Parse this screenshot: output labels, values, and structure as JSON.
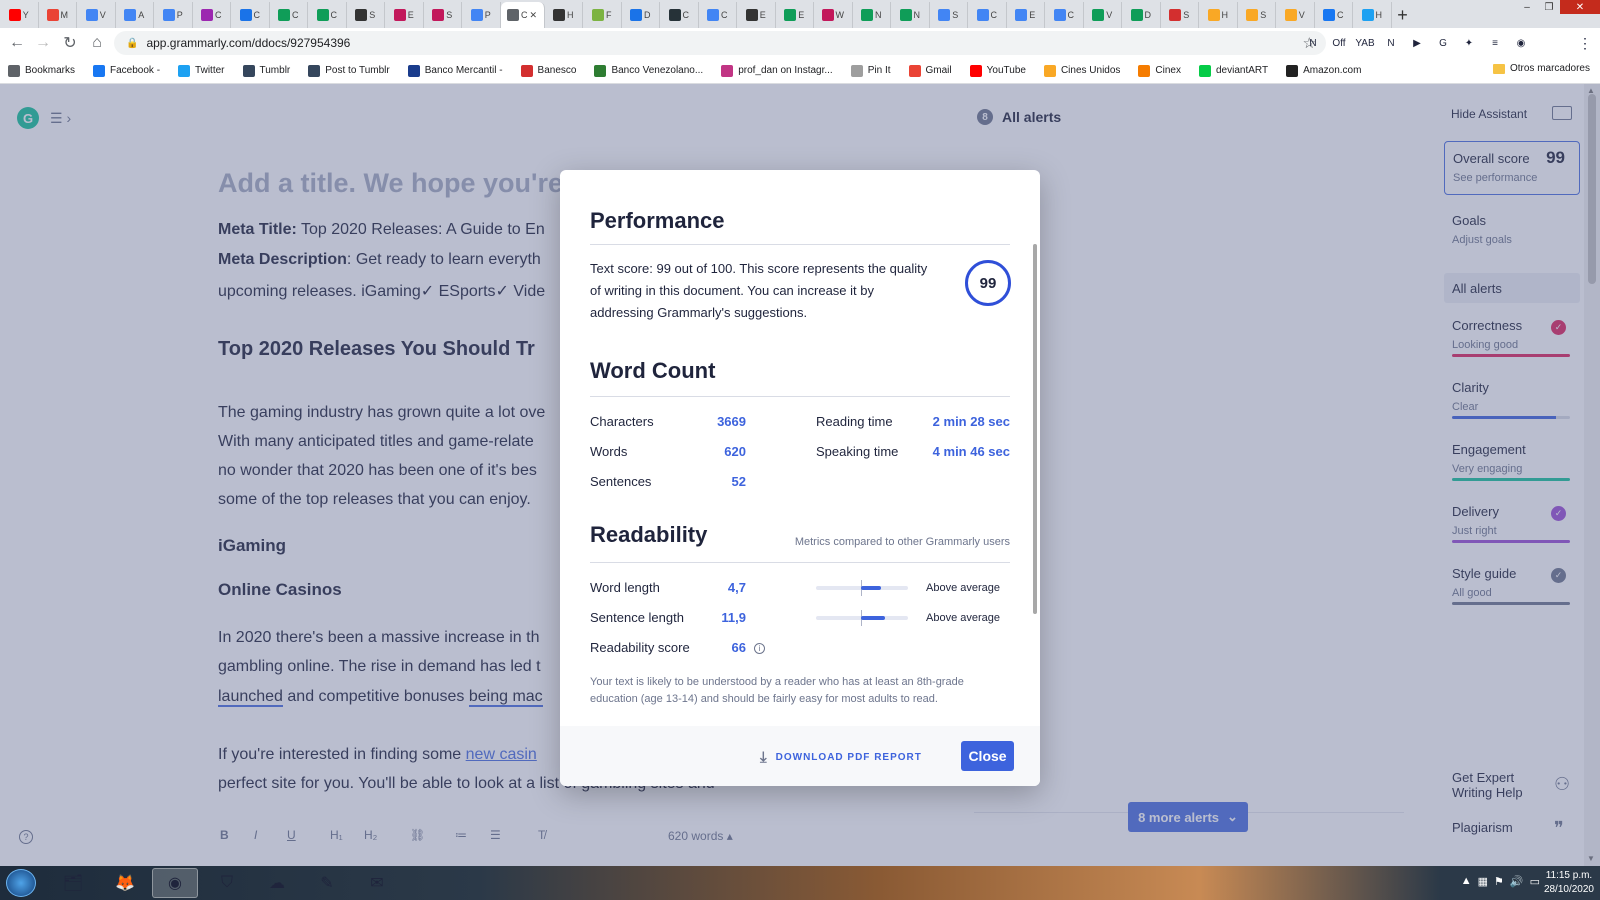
{
  "browser": {
    "url": "app.grammarly.com/ddocs/927954396",
    "tabs": [
      {
        "label": "Y",
        "color": "#ff0000"
      },
      {
        "label": "M",
        "color": "#ea4335"
      },
      {
        "label": "V",
        "color": "#4285f4"
      },
      {
        "label": "A",
        "color": "#4285f4"
      },
      {
        "label": "P",
        "color": "#4285f4"
      },
      {
        "label": "C",
        "color": "#9c27b0"
      },
      {
        "label": "C",
        "color": "#1a73e8"
      },
      {
        "label": "C",
        "color": "#0f9d58"
      },
      {
        "label": "C",
        "color": "#0f9d58"
      },
      {
        "label": "S",
        "color": "#333333"
      },
      {
        "label": "E",
        "color": "#c2185b"
      },
      {
        "label": "S",
        "color": "#c2185b"
      },
      {
        "label": "P",
        "color": "#4285f4"
      },
      {
        "label": "C",
        "color": "#5f6368"
      },
      {
        "label": "H",
        "color": "#333333"
      },
      {
        "label": "F",
        "color": "#7cb342"
      },
      {
        "label": "D",
        "color": "#1a73e8"
      },
      {
        "label": "C",
        "color": "#263238"
      },
      {
        "label": "C",
        "color": "#4285f4"
      },
      {
        "label": "E",
        "color": "#333333"
      },
      {
        "label": "E",
        "color": "#0f9d58"
      },
      {
        "label": "W",
        "color": "#c2185b"
      },
      {
        "label": "N",
        "color": "#0f9d58"
      },
      {
        "label": "N",
        "color": "#0f9d58"
      },
      {
        "label": "S",
        "color": "#4285f4"
      },
      {
        "label": "C",
        "color": "#4285f4"
      },
      {
        "label": "E",
        "color": "#4285f4"
      },
      {
        "label": "C",
        "color": "#4285f4"
      },
      {
        "label": "V",
        "color": "#0f9d58"
      },
      {
        "label": "D",
        "color": "#0f9d58"
      },
      {
        "label": "S",
        "color": "#d32f2f"
      },
      {
        "label": "H",
        "color": "#f9a825"
      },
      {
        "label": "S",
        "color": "#f9a825"
      },
      {
        "label": "V",
        "color": "#f9a825"
      },
      {
        "label": "C",
        "color": "#1877f2"
      },
      {
        "label": "H",
        "color": "#1da1f2"
      }
    ],
    "active_tab_label": "C",
    "bookmarks": [
      {
        "label": "Bookmarks",
        "color": "#5f6368"
      },
      {
        "label": "Facebook -",
        "color": "#1877f2"
      },
      {
        "label": "Twitter",
        "color": "#1da1f2"
      },
      {
        "label": "Tumblr",
        "color": "#35465c"
      },
      {
        "label": "Post to Tumblr",
        "color": "#35465c"
      },
      {
        "label": "Banco Mercantil -",
        "color": "#1a3c8c"
      },
      {
        "label": "Banesco",
        "color": "#d32f2f"
      },
      {
        "label": "Banco Venezolano...",
        "color": "#2e7d32"
      },
      {
        "label": "prof_dan on Instagr...",
        "color": "#c13584"
      },
      {
        "label": "Pin It",
        "color": "#9e9e9e"
      },
      {
        "label": "Gmail",
        "color": "#ea4335"
      },
      {
        "label": "YouTube",
        "color": "#ff0000"
      },
      {
        "label": "Cines Unidos",
        "color": "#f9a825"
      },
      {
        "label": "Cinex",
        "color": "#f57c00"
      },
      {
        "label": "deviantART",
        "color": "#05cc47"
      },
      {
        "label": "Amazon.com",
        "color": "#222222"
      }
    ],
    "other_bookmarks": "Otros marcadores",
    "extensions": [
      "N",
      "Off",
      "YAB",
      "N",
      "▶",
      "G",
      "✦",
      "≡",
      "◉"
    ]
  },
  "editor": {
    "top_alerts_count": "8",
    "top_alerts_label": "All alerts",
    "title_placeholder": "Add a title. We hope you're",
    "meta_title_label": "Meta Title:",
    "meta_title_text": " Top 2020 Releases: A Guide to En",
    "meta_desc_label": "Meta Description",
    "meta_desc_text": ": Get ready to learn everyth",
    "meta_desc_line2": "upcoming releases. iGaming✓ ESports✓ Vide",
    "heading1": "Top 2020 Releases You Should Tr",
    "para1": [
      "The gaming industry has grown quite a lot ove",
      "With many anticipated titles and game-relate",
      "no wonder that 2020 has been one of it's bes",
      "some of the top releases that you can enjoy."
    ],
    "heading_igaming": "iGaming",
    "heading_casinos": "Online Casinos",
    "para2_line1": "In 2020 there's been a massive increase in th",
    "para2_line2": "gambling online. The rise in demand has led t",
    "para2_line3a": "launched",
    "para2_line3b": " and competitive bonuses ",
    "para2_line3c": "being mac",
    "para3_line1a": "If you're interested in finding some ",
    "para3_line1b": "new casin",
    "para3_line2": "perfect site for you. You'll be able to look at a list of gambling sites and",
    "word_count": "620 words ▴",
    "more_alerts": "8 more alerts"
  },
  "sidebar": {
    "hide_assistant": "Hide Assistant",
    "overall_score_label": "Overall score",
    "overall_score": "99",
    "see_performance": "See performance",
    "goals": "Goals",
    "adjust_goals": "Adjust goals",
    "all_alerts": "All alerts",
    "categories": [
      {
        "name": "Correctness",
        "status": "Looking good",
        "color": "#e0245e",
        "check": true
      },
      {
        "name": "Clarity",
        "status": "Clear",
        "color": "#3d63dd",
        "check": false
      },
      {
        "name": "Engagement",
        "status": "Very engaging",
        "color": "#15c39a",
        "check": false
      },
      {
        "name": "Delivery",
        "status": "Just right",
        "color": "#9c4fd6",
        "check": true
      },
      {
        "name": "Style guide",
        "status": "All good",
        "color": "#6d758d",
        "check": true
      }
    ],
    "expert_line1": "Get Expert",
    "expert_line2": "Writing Help",
    "plagiarism": "Plagiarism"
  },
  "modal": {
    "performance_title": "Performance",
    "performance_text": "Text score: 99 out of 100. This score represents the quality of writing in this document. You can increase it by addressing Grammarly's suggestions.",
    "score": "99",
    "wordcount_title": "Word Count",
    "characters_label": "Characters",
    "characters": "3669",
    "words_label": "Words",
    "words": "620",
    "sentences_label": "Sentences",
    "sentences": "52",
    "reading_time_label": "Reading time",
    "reading_time": "2 min 28 sec",
    "speaking_time_label": "Speaking time",
    "speaking_time": "4 min 46 sec",
    "readability_title": "Readability",
    "readability_note": "Metrics compared to other Grammarly users",
    "word_length_label": "Word length",
    "word_length": "4,7",
    "word_length_rating": "Above average",
    "sentence_length_label": "Sentence length",
    "sentence_length": "11,9",
    "sentence_length_rating": "Above average",
    "readability_score_label": "Readability score",
    "readability_score": "66",
    "explanation": "Your text is likely to be understood by a reader who has at least an 8th-grade education (age 13-14) and should be fairly easy for most adults to read.",
    "download_label": "DOWNLOAD PDF REPORT",
    "close_label": "Close"
  },
  "taskbar": {
    "time": "11:15 p.m.",
    "date": "28/10/2020"
  }
}
